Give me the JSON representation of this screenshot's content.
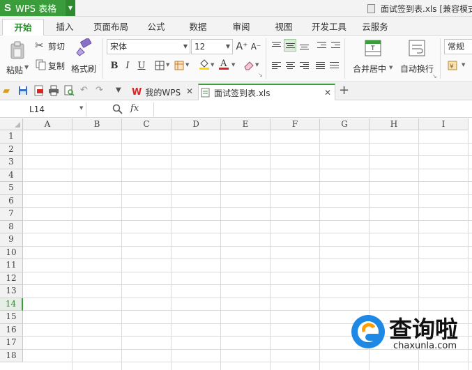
{
  "titlebar": {
    "app_logo": "S",
    "app_name": "WPS 表格",
    "document_title": "面试签到表.xls [兼容模式]"
  },
  "ribbon_tabs": [
    "开始",
    "插入",
    "页面布局",
    "公式",
    "数据",
    "审阅",
    "视图",
    "开发工具",
    "云服务"
  ],
  "clipboard": {
    "paste": "粘贴",
    "cut": "剪切",
    "copy": "复制",
    "format_painter": "格式刷"
  },
  "font": {
    "name": "宋体",
    "size": "12",
    "grow": "A⁺",
    "shrink": "A⁻",
    "bold": "B",
    "italic": "I",
    "underline": "U"
  },
  "alignment": {
    "merge_center": "合并居中",
    "wrap_text": "自动换行"
  },
  "number": {
    "format": "常规"
  },
  "doc_tabs": [
    {
      "label": "我的WPS",
      "active": false
    },
    {
      "label": "面试签到表.xls",
      "active": true
    }
  ],
  "formula_bar": {
    "name_box": "L14",
    "fx": "fx",
    "value": ""
  },
  "sheet": {
    "columns": [
      "A",
      "B",
      "C",
      "D",
      "E",
      "F",
      "G",
      "H",
      "I"
    ],
    "rows": [
      "1",
      "2",
      "3",
      "4",
      "5",
      "6",
      "7",
      "8",
      "9",
      "10",
      "11",
      "12",
      "13",
      "14",
      "15",
      "16",
      "17",
      "18"
    ],
    "active_row": "14"
  },
  "watermark": {
    "brand": "查询啦",
    "domain": "chaxunla.com"
  },
  "colors": {
    "accent_green": "#3a9c3a",
    "grid_line": "#dadada",
    "header_bg": "#f2f2f2"
  }
}
